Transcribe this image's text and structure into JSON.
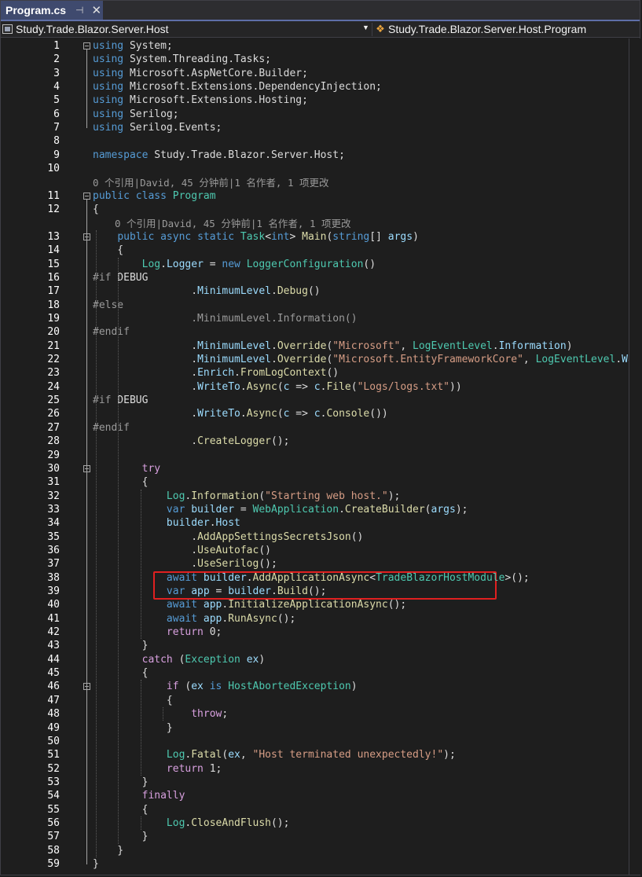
{
  "tab": {
    "title": "Program.cs",
    "pin_glyph": "⊣",
    "close_glyph": "✕"
  },
  "nav": {
    "project": "Study.Trade.Blazor.Server.Host",
    "member": "Study.Trade.Blazor.Server.Host.Program",
    "arrow_glyph": "▼"
  },
  "codelens": [
    "0 个引用|David, 45 分钟前|1 名作者, 1 项更改",
    "0 个引用|David, 45 分钟前|1 名作者, 1 项更改"
  ],
  "lines": [
    {
      "n": "1",
      "t": [
        [
          "kw",
          "using"
        ],
        [
          "",
          " System;"
        ]
      ]
    },
    {
      "n": "2",
      "t": [
        [
          "kw",
          "using"
        ],
        [
          "",
          " System.Threading.Tasks;"
        ]
      ]
    },
    {
      "n": "3",
      "t": [
        [
          "kw",
          "using"
        ],
        [
          "",
          " Microsoft.AspNetCore.Builder;"
        ]
      ]
    },
    {
      "n": "4",
      "t": [
        [
          "kw",
          "using"
        ],
        [
          "",
          " Microsoft.Extensions.DependencyInjection;"
        ]
      ]
    },
    {
      "n": "5",
      "t": [
        [
          "kw",
          "using"
        ],
        [
          "",
          " Microsoft.Extensions.Hosting;"
        ]
      ]
    },
    {
      "n": "6",
      "t": [
        [
          "kw",
          "using"
        ],
        [
          "",
          " Serilog;"
        ]
      ]
    },
    {
      "n": "7",
      "t": [
        [
          "kw",
          "using"
        ],
        [
          "",
          " Serilog.Events;"
        ]
      ]
    },
    {
      "n": "8",
      "t": []
    },
    {
      "n": "9",
      "t": [
        [
          "kw",
          "namespace"
        ],
        [
          "",
          " Study.Trade.Blazor.Server.Host;"
        ]
      ]
    },
    {
      "n": "10",
      "t": []
    },
    {
      "n": "11",
      "t": [
        [
          "kw",
          "public"
        ],
        [
          "",
          " "
        ],
        [
          "kw",
          "class"
        ],
        [
          "",
          " "
        ],
        [
          "ty",
          "Program"
        ]
      ]
    },
    {
      "n": "12",
      "t": [
        [
          "",
          "{"
        ]
      ]
    },
    {
      "n": "13",
      "t": [
        [
          "",
          "    "
        ],
        [
          "kw",
          "public"
        ],
        [
          "",
          " "
        ],
        [
          "kw",
          "async"
        ],
        [
          "",
          " "
        ],
        [
          "kw",
          "static"
        ],
        [
          "",
          " "
        ],
        [
          "ty",
          "Task"
        ],
        [
          "",
          "<"
        ],
        [
          "kw",
          "int"
        ],
        [
          "",
          "> "
        ],
        [
          "me",
          "Main"
        ],
        [
          "",
          "("
        ],
        [
          "kw",
          "string"
        ],
        [
          "",
          "[] "
        ],
        [
          "va",
          "args"
        ],
        [
          "",
          ")"
        ]
      ]
    },
    {
      "n": "14",
      "t": [
        [
          "",
          "    {"
        ]
      ]
    },
    {
      "n": "15",
      "t": [
        [
          "",
          "        "
        ],
        [
          "ty",
          "Log"
        ],
        [
          "",
          "."
        ],
        [
          "va",
          "Logger"
        ],
        [
          "",
          " = "
        ],
        [
          "kw",
          "new"
        ],
        [
          "",
          " "
        ],
        [
          "ty",
          "LoggerConfiguration"
        ],
        [
          "",
          "()"
        ]
      ]
    },
    {
      "n": "16",
      "t": [
        [
          "pp",
          "#if"
        ],
        [
          "",
          " DEBUG"
        ]
      ]
    },
    {
      "n": "17",
      "t": [
        [
          "",
          "                ."
        ],
        [
          "va",
          "MinimumLevel"
        ],
        [
          "",
          "."
        ],
        [
          "me",
          "Debug"
        ],
        [
          "",
          "()"
        ]
      ]
    },
    {
      "n": "18",
      "t": [
        [
          "pp",
          "#else"
        ]
      ]
    },
    {
      "n": "19",
      "t": [
        [
          "pp",
          "                .MinimumLevel.Information()"
        ]
      ]
    },
    {
      "n": "20",
      "t": [
        [
          "pp",
          "#endif"
        ]
      ]
    },
    {
      "n": "21",
      "t": [
        [
          "",
          "                ."
        ],
        [
          "va",
          "MinimumLevel"
        ],
        [
          "",
          "."
        ],
        [
          "me",
          "Override"
        ],
        [
          "",
          "("
        ],
        [
          "st",
          "\"Microsoft\""
        ],
        [
          "",
          ", "
        ],
        [
          "ty",
          "LogEventLevel"
        ],
        [
          "",
          "."
        ],
        [
          "va",
          "Information"
        ],
        [
          "",
          ")"
        ]
      ]
    },
    {
      "n": "22",
      "t": [
        [
          "",
          "                ."
        ],
        [
          "va",
          "MinimumLevel"
        ],
        [
          "",
          "."
        ],
        [
          "me",
          "Override"
        ],
        [
          "",
          "("
        ],
        [
          "st",
          "\"Microsoft.EntityFrameworkCore\""
        ],
        [
          "",
          ", "
        ],
        [
          "ty",
          "LogEventLevel"
        ],
        [
          "",
          "."
        ],
        [
          "va",
          "Warning"
        ],
        [
          "",
          ")"
        ]
      ]
    },
    {
      "n": "23",
      "t": [
        [
          "",
          "                ."
        ],
        [
          "va",
          "Enrich"
        ],
        [
          "",
          "."
        ],
        [
          "me",
          "FromLogContext"
        ],
        [
          "",
          "()"
        ]
      ]
    },
    {
      "n": "24",
      "t": [
        [
          "",
          "                ."
        ],
        [
          "va",
          "WriteTo"
        ],
        [
          "",
          "."
        ],
        [
          "me",
          "Async"
        ],
        [
          "",
          "("
        ],
        [
          "va",
          "c"
        ],
        [
          "",
          " => "
        ],
        [
          "va",
          "c"
        ],
        [
          "",
          "."
        ],
        [
          "me",
          "File"
        ],
        [
          "",
          "("
        ],
        [
          "st",
          "\"Logs/logs.txt\""
        ],
        [
          "",
          "))"
        ]
      ]
    },
    {
      "n": "25",
      "t": [
        [
          "pp",
          "#if"
        ],
        [
          "",
          " DEBUG"
        ]
      ]
    },
    {
      "n": "26",
      "t": [
        [
          "",
          "                ."
        ],
        [
          "va",
          "WriteTo"
        ],
        [
          "",
          "."
        ],
        [
          "me",
          "Async"
        ],
        [
          "",
          "("
        ],
        [
          "va",
          "c"
        ],
        [
          "",
          " => "
        ],
        [
          "va",
          "c"
        ],
        [
          "",
          "."
        ],
        [
          "me",
          "Console"
        ],
        [
          "",
          "())"
        ]
      ]
    },
    {
      "n": "27",
      "t": [
        [
          "pp",
          "#endif"
        ]
      ]
    },
    {
      "n": "28",
      "t": [
        [
          "",
          "                ."
        ],
        [
          "me",
          "CreateLogger"
        ],
        [
          "",
          "();"
        ]
      ]
    },
    {
      "n": "29",
      "t": []
    },
    {
      "n": "30",
      "t": [
        [
          "",
          "        "
        ],
        [
          "ctl",
          "try"
        ]
      ]
    },
    {
      "n": "31",
      "t": [
        [
          "",
          "        {"
        ]
      ]
    },
    {
      "n": "32",
      "t": [
        [
          "",
          "            "
        ],
        [
          "ty",
          "Log"
        ],
        [
          "",
          "."
        ],
        [
          "me",
          "Information"
        ],
        [
          "",
          "("
        ],
        [
          "st",
          "\"Starting web host.\""
        ],
        [
          "",
          ");"
        ]
      ]
    },
    {
      "n": "33",
      "t": [
        [
          "",
          "            "
        ],
        [
          "kw",
          "var"
        ],
        [
          "",
          " "
        ],
        [
          "va",
          "builder"
        ],
        [
          "",
          " = "
        ],
        [
          "ty",
          "WebApplication"
        ],
        [
          "",
          "."
        ],
        [
          "me",
          "CreateBuilder"
        ],
        [
          "",
          "("
        ],
        [
          "va",
          "args"
        ],
        [
          "",
          ");"
        ]
      ]
    },
    {
      "n": "34",
      "t": [
        [
          "",
          "            "
        ],
        [
          "va",
          "builder"
        ],
        [
          "",
          "."
        ],
        [
          "va",
          "Host"
        ]
      ]
    },
    {
      "n": "35",
      "t": [
        [
          "",
          "                ."
        ],
        [
          "me",
          "AddAppSettingsSecretsJson"
        ],
        [
          "",
          "()"
        ]
      ]
    },
    {
      "n": "36",
      "t": [
        [
          "",
          "                ."
        ],
        [
          "me",
          "UseAutofac"
        ],
        [
          "",
          "()"
        ]
      ]
    },
    {
      "n": "37",
      "t": [
        [
          "",
          "                ."
        ],
        [
          "me",
          "UseSerilog"
        ],
        [
          "",
          "();"
        ]
      ]
    },
    {
      "n": "38",
      "t": [
        [
          "",
          "            "
        ],
        [
          "kw",
          "await"
        ],
        [
          "",
          " "
        ],
        [
          "va",
          "builder"
        ],
        [
          "",
          "."
        ],
        [
          "me",
          "AddApplicationAsync"
        ],
        [
          "",
          "<"
        ],
        [
          "ty",
          "TradeBlazorHostModule"
        ],
        [
          "",
          ">();"
        ]
      ]
    },
    {
      "n": "39",
      "t": [
        [
          "",
          "            "
        ],
        [
          "kw",
          "var"
        ],
        [
          "",
          " "
        ],
        [
          "va",
          "app"
        ],
        [
          "",
          " = "
        ],
        [
          "va",
          "builder"
        ],
        [
          "",
          "."
        ],
        [
          "me",
          "Build"
        ],
        [
          "",
          "();"
        ]
      ]
    },
    {
      "n": "40",
      "t": [
        [
          "",
          "            "
        ],
        [
          "kw",
          "await"
        ],
        [
          "",
          " "
        ],
        [
          "va",
          "app"
        ],
        [
          "",
          "."
        ],
        [
          "me",
          "InitializeApplicationAsync"
        ],
        [
          "",
          "();"
        ]
      ]
    },
    {
      "n": "41",
      "t": [
        [
          "",
          "            "
        ],
        [
          "kw",
          "await"
        ],
        [
          "",
          " "
        ],
        [
          "va",
          "app"
        ],
        [
          "",
          "."
        ],
        [
          "me",
          "RunAsync"
        ],
        [
          "",
          "();"
        ]
      ]
    },
    {
      "n": "42",
      "t": [
        [
          "",
          "            "
        ],
        [
          "ctl",
          "return"
        ],
        [
          "",
          " 0;"
        ]
      ]
    },
    {
      "n": "43",
      "t": [
        [
          "",
          "        }"
        ]
      ]
    },
    {
      "n": "44",
      "t": [
        [
          "",
          "        "
        ],
        [
          "ctl",
          "catch"
        ],
        [
          "",
          " ("
        ],
        [
          "ty",
          "Exception"
        ],
        [
          "",
          " "
        ],
        [
          "va",
          "ex"
        ],
        [
          "",
          ")"
        ]
      ]
    },
    {
      "n": "45",
      "t": [
        [
          "",
          "        {"
        ]
      ]
    },
    {
      "n": "46",
      "t": [
        [
          "",
          "            "
        ],
        [
          "ctl",
          "if"
        ],
        [
          "",
          " ("
        ],
        [
          "va",
          "ex"
        ],
        [
          "",
          " "
        ],
        [
          "kw",
          "is"
        ],
        [
          "",
          " "
        ],
        [
          "ty",
          "HostAbortedException"
        ],
        [
          "",
          ")"
        ]
      ]
    },
    {
      "n": "47",
      "t": [
        [
          "",
          "            {"
        ]
      ]
    },
    {
      "n": "48",
      "t": [
        [
          "",
          "                "
        ],
        [
          "ctl",
          "throw"
        ],
        [
          "",
          ";"
        ]
      ]
    },
    {
      "n": "49",
      "t": [
        [
          "",
          "            }"
        ]
      ]
    },
    {
      "n": "50",
      "t": []
    },
    {
      "n": "51",
      "t": [
        [
          "",
          "            "
        ],
        [
          "ty",
          "Log"
        ],
        [
          "",
          "."
        ],
        [
          "me",
          "Fatal"
        ],
        [
          "",
          "("
        ],
        [
          "va",
          "ex"
        ],
        [
          "",
          ", "
        ],
        [
          "st",
          "\"Host terminated unexpectedly!\""
        ],
        [
          "",
          ");"
        ]
      ]
    },
    {
      "n": "52",
      "t": [
        [
          "",
          "            "
        ],
        [
          "ctl",
          "return"
        ],
        [
          "",
          " 1;"
        ]
      ]
    },
    {
      "n": "53",
      "t": [
        [
          "",
          "        }"
        ]
      ]
    },
    {
      "n": "54",
      "t": [
        [
          "",
          "        "
        ],
        [
          "ctl",
          "finally"
        ]
      ]
    },
    {
      "n": "55",
      "t": [
        [
          "",
          "        {"
        ]
      ]
    },
    {
      "n": "56",
      "t": [
        [
          "",
          "            "
        ],
        [
          "ty",
          "Log"
        ],
        [
          "",
          "."
        ],
        [
          "me",
          "CloseAndFlush"
        ],
        [
          "",
          "();"
        ]
      ]
    },
    {
      "n": "57",
      "t": [
        [
          "",
          "        }"
        ]
      ]
    },
    {
      "n": "58",
      "t": [
        [
          "",
          "    }"
        ]
      ]
    },
    {
      "n": "59",
      "t": [
        [
          "",
          "}"
        ]
      ]
    }
  ]
}
